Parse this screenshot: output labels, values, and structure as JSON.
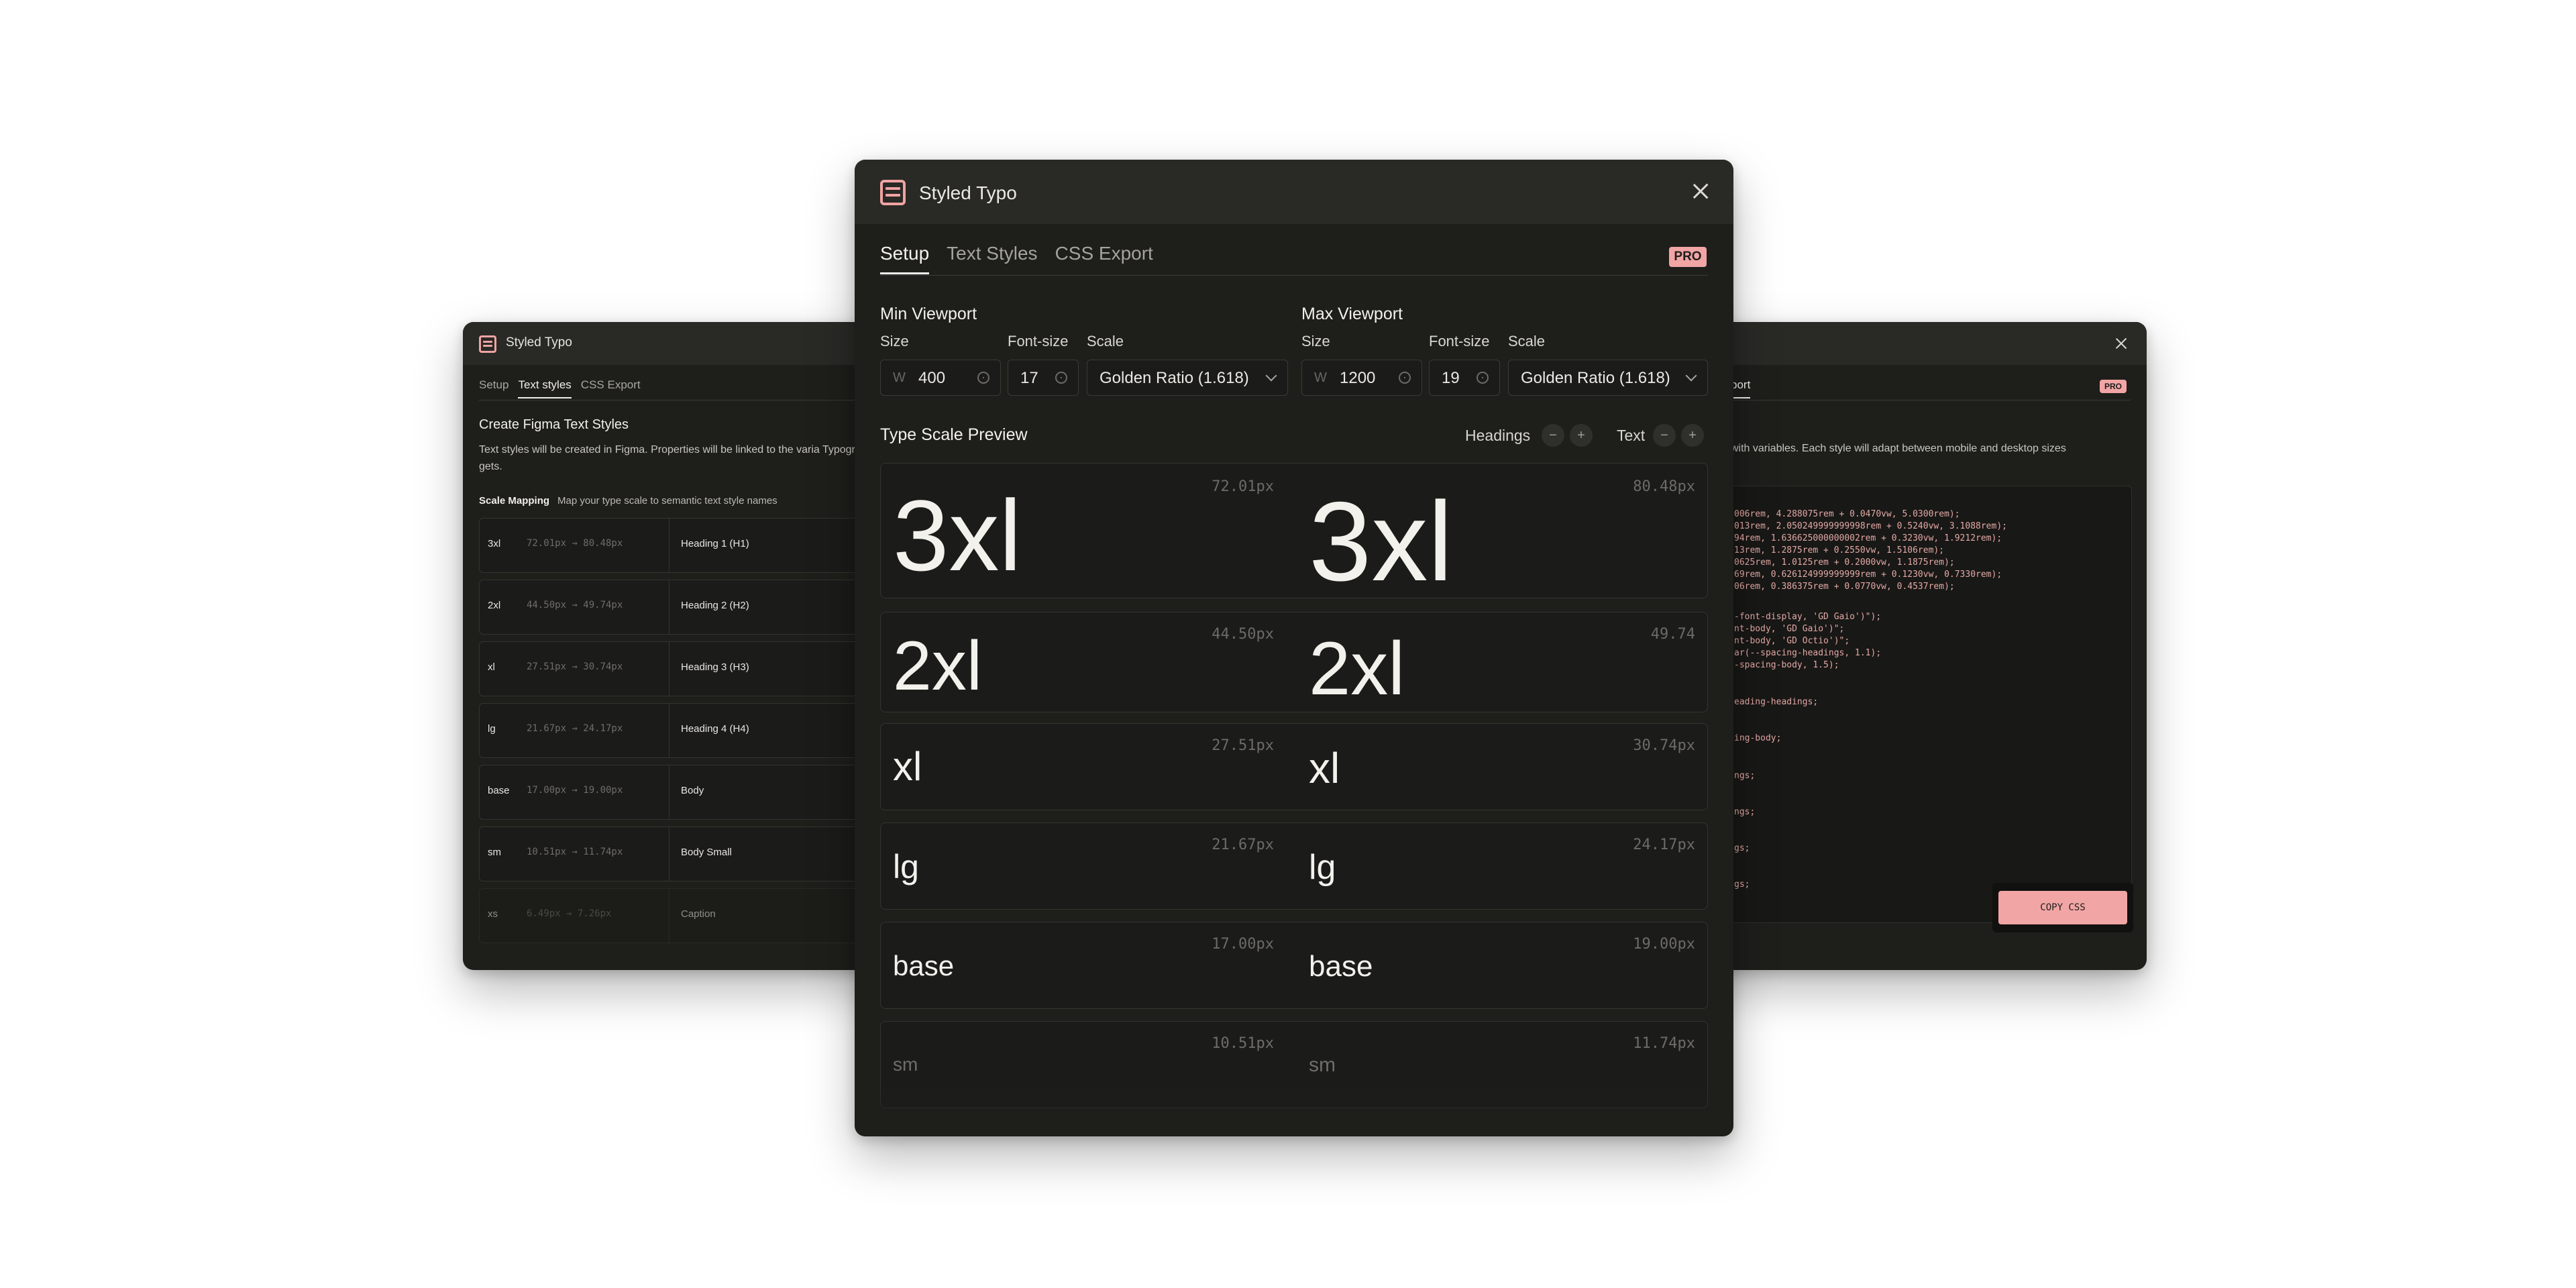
{
  "app_title": "Styled Typo",
  "left_window": {
    "title": "Styled Typo",
    "tabs": [
      "Setup",
      "Text styles",
      "CSS Export"
    ],
    "active_tab": "Text styles",
    "heading": "Create Figma Text Styles",
    "description": "Text styles will be created in Figma. Properties will be linked to the varia Typography. Smart as it gets.",
    "mapping_title": "Scale Mapping",
    "mapping_hint": "Map your type scale to semantic text style names",
    "rows": [
      {
        "key": "3xl",
        "range": "72.01px → 80.48px",
        "style": "Heading 1 (H1)"
      },
      {
        "key": "2xl",
        "range": "44.50px → 49.74px",
        "style": "Heading 2 (H2)"
      },
      {
        "key": "xl",
        "range": "27.51px → 30.74px",
        "style": "Heading 3 (H3)"
      },
      {
        "key": "lg",
        "range": "21.67px → 24.17px",
        "style": "Heading 4 (H4)"
      },
      {
        "key": "base",
        "range": "17.00px → 19.00px",
        "style": "Body"
      },
      {
        "key": "sm",
        "range": "10.51px → 11.74px",
        "style": "Body Small"
      },
      {
        "key": "xs",
        "range": "6.49px → 7.26px",
        "style": "Caption"
      }
    ]
  },
  "right_window": {
    "tab_label": "port",
    "badge": "PRO",
    "description": "with variables. Each style will adapt between mobile and desktop sizes",
    "code_lines": [
      "006rem, 4.288075rem + 0.0470vw, 5.0300rem);",
      "013rem, 2.050249999999998rem + 0.5240vw, 3.1088rem);",
      "94rem, 1.636625000000002rem + 0.3230vw, 1.9212rem);",
      "13rem, 1.2875rem + 0.2550vw, 1.5106rem);",
      "0625rem, 1.0125rem + 0.2000vw, 1.1875rem);",
      "69rem, 0.626124999999999rem + 0.1230vw, 0.7330rem);",
      "06rem, 0.386375rem + 0.0770vw, 0.4537rem);",
      "",
      "-font-display, 'GD Gaio')\");",
      "nt-body, 'GD Gaio')\";",
      "nt-body, 'GD Octio')\";",
      "ar(--spacing-headings, 1.1);",
      "-spacing-body, 1.5);",
      "",
      "",
      "eading-headings;",
      "",
      "ing-body;",
      "",
      "ngs;",
      "",
      "ngs;",
      "",
      "gs;",
      "",
      "gs;"
    ],
    "copy_button": "COPY CSS"
  },
  "main_window": {
    "title": "Styled Typo",
    "tabs": [
      "Setup",
      "Text Styles",
      "CSS Export"
    ],
    "active_tab": "Setup",
    "badge": "PRO",
    "min_viewport": {
      "title": "Min Viewport",
      "size_label": "Size",
      "fontsize_label": "Font-size",
      "scale_label": "Scale",
      "width_prefix": "W",
      "width": "400",
      "font_size": "17",
      "scale": "Golden Ratio (1.618)"
    },
    "max_viewport": {
      "title": "Max Viewport",
      "size_label": "Size",
      "fontsize_label": "Font-size",
      "scale_label": "Scale",
      "width_prefix": "W",
      "width": "1200",
      "font_size": "19",
      "scale": "Golden Ratio (1.618)"
    },
    "preview_title": "Type Scale Preview",
    "headings_label": "Headings",
    "text_label": "Text",
    "minus": "−",
    "plus": "+",
    "scale_rows": [
      {
        "name": "3xl",
        "min_px": "72.01px",
        "max_px": "80.48px"
      },
      {
        "name": "2xl",
        "min_px": "44.50px",
        "max_px": "49.74"
      },
      {
        "name": "xl",
        "min_px": "27.51px",
        "max_px": "30.74px"
      },
      {
        "name": "lg",
        "min_px": "21.67px",
        "max_px": "24.17px"
      },
      {
        "name": "base",
        "min_px": "17.00px",
        "max_px": "19.00px"
      },
      {
        "name": "sm",
        "min_px": "10.51px",
        "max_px": "11.74px"
      }
    ]
  },
  "colors": {
    "window_bg": "#1e1e1b",
    "titlebar_bg": "#292926",
    "accent": "#f2a5a5",
    "code_text": "#e3a9a6"
  },
  "icons": {
    "logo": "stacked-lines-logo-icon",
    "close": "close-icon",
    "chevron": "chevron-down-icon",
    "spinner": "stepper-icon"
  }
}
